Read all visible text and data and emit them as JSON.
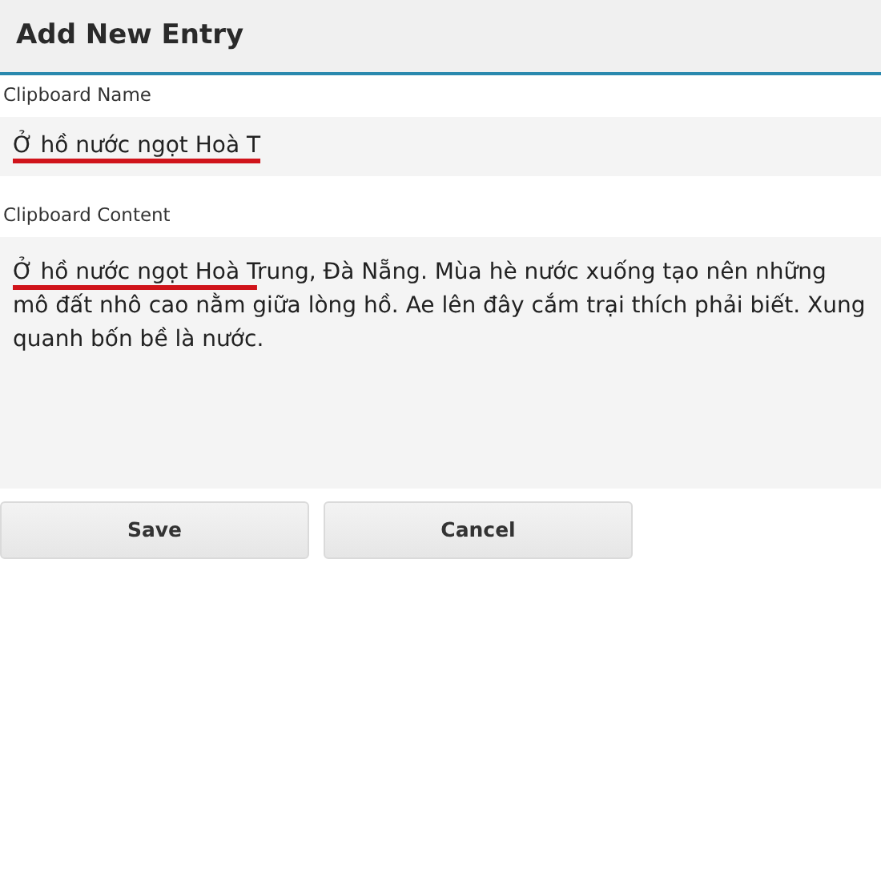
{
  "header": {
    "title": "Add New Entry"
  },
  "fields": [
    {
      "label": "Clipboard Name",
      "kind": "line",
      "segments": [
        {
          "text": "Ở hồ nước ngọt Hoà T",
          "marked": true
        }
      ]
    },
    {
      "label": "Clipboard Content",
      "kind": "area",
      "segments": [
        {
          "text": "Ở hồ nước ngọt Hoà T",
          "marked": true
        },
        {
          "text": "rung, Đà Nẵng. Mùa hè nước xuống tạo nên những mô đất nhô cao nằm giữa lòng hồ. Ae lên đây cắm trại thích phải biết. Xung quanh bốn bề là nước.",
          "marked": false
        }
      ]
    }
  ],
  "buttons": [
    "Save",
    "Cancel"
  ]
}
